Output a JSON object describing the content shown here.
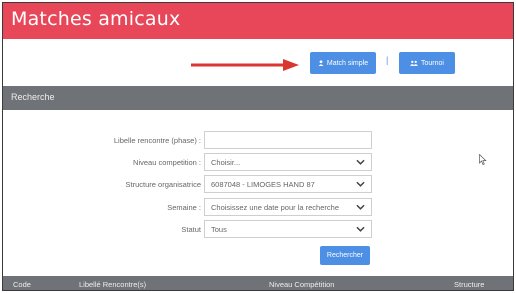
{
  "header": {
    "title": "Matches amicaux"
  },
  "toolbar": {
    "match_simple_label": "Match simple",
    "separator": "|",
    "tournoi_label": "Tournoi"
  },
  "search": {
    "section_title": "Recherche",
    "fields": {
      "libelle_label": "Libelle rencontre (phase) :",
      "libelle_value": "",
      "niveau_label": "Niveau competition :",
      "niveau_value": "Choisir...",
      "structure_label": "Structure organisatrice",
      "structure_value": "6087048 - LIMOGES HAND 87",
      "semaine_label": "Semaine :",
      "semaine_value": "Choisissez une date pour la recherche",
      "statut_label": "Statut",
      "statut_value": "Tous"
    },
    "submit_label": "Rechercher"
  },
  "table": {
    "columns": [
      "Code",
      "Libellé Rencontre(s)",
      "Niveau Compétition",
      "Structure"
    ]
  },
  "colors": {
    "header_bg": "#e8475a",
    "section_bg": "#6f7277",
    "button_bg": "#4d8fe4",
    "arrow": "#d9362f"
  }
}
